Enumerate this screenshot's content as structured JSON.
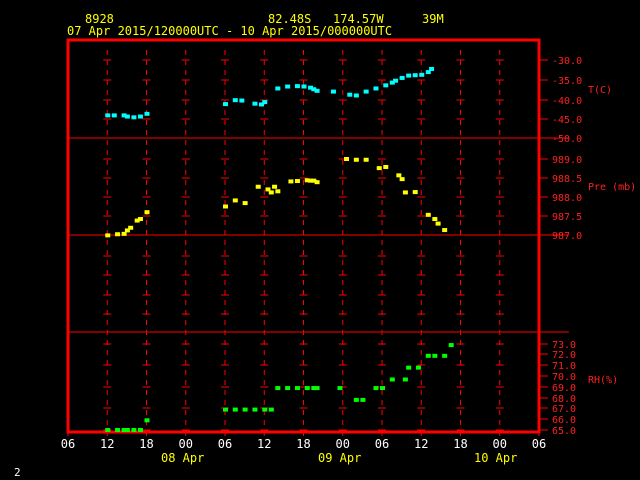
{
  "header": {
    "station_id": "8928",
    "latitude": "82.48S",
    "longitude": "174.57W",
    "elevation": "39M",
    "time_range": "07 Apr 2015/120000UTC - 10 Apr 2015/000000UTC"
  },
  "footer": {
    "page_number": "2"
  },
  "colors": {
    "frame": "#ff0000",
    "temperature": "#00ffff",
    "pressure": "#ffff00",
    "rh": "#00ff00",
    "axis_text": "#ff2020"
  },
  "x_axis": {
    "hour_ticks": [
      "06",
      "12",
      "18",
      "00",
      "06",
      "12",
      "18",
      "00",
      "06",
      "12",
      "18",
      "00",
      "06"
    ],
    "day_labels": [
      "08 Apr",
      "09 Apr",
      "10 Apr"
    ]
  },
  "chart_data": [
    {
      "type": "scatter",
      "title": "",
      "ylabel": "T(C)",
      "ylim": [
        -50.0,
        -30.0
      ],
      "yticks": [
        "-30.0",
        "-35.0",
        "-40.0",
        "-45.0",
        "-50.0"
      ],
      "x_units": "hours since 07 Apr 2015 06 UTC",
      "xlim": [
        0,
        72
      ],
      "series": [
        {
          "name": "T(C)",
          "color": "#00ffff",
          "x": [
            6,
            7,
            8.5,
            9,
            10,
            11,
            12,
            24,
            25.5,
            26.5,
            28.5,
            29.5,
            30,
            32,
            33.5,
            35,
            36,
            37,
            37.5,
            38,
            40.5,
            43,
            44,
            45.5,
            47,
            48.5,
            49.5,
            50,
            51,
            52,
            53,
            54,
            55,
            55.5
          ],
          "y": [
            -44.2,
            -44.2,
            -44.2,
            -44.5,
            -44.7,
            -44.5,
            -43.8,
            -41.3,
            -40.3,
            -40.4,
            -41.2,
            -41.4,
            -40.8,
            -37.3,
            -36.8,
            -36.7,
            -36.8,
            -37.1,
            -37.5,
            -37.9,
            -38.1,
            -38.9,
            -39.1,
            -38.1,
            -37.3,
            -36.5,
            -35.8,
            -35.3,
            -34.6,
            -34.0,
            -33.9,
            -33.8,
            -33.1,
            -32.3
          ]
        }
      ]
    },
    {
      "type": "scatter",
      "title": "",
      "ylabel": "Pre (mb)",
      "ylim": [
        986.8,
        989.2
      ],
      "yticks": [
        "989.0",
        "988.5",
        "988.0",
        "987.5",
        "987.0"
      ],
      "x_units": "hours since 07 Apr 2015 06 UTC",
      "xlim": [
        0,
        72
      ],
      "series": [
        {
          "name": "Pre (mb)",
          "color": "#ffff00",
          "x": [
            6,
            7.5,
            8.5,
            9,
            9.5,
            10.5,
            11,
            12,
            24,
            25.5,
            27,
            29,
            30.5,
            31,
            31.5,
            32,
            34,
            35,
            36.5,
            37,
            37.5,
            38,
            42.5,
            44,
            45.5,
            47.5,
            48.5,
            50.5,
            51,
            51.5,
            53,
            55,
            56,
            56.5,
            57.5
          ],
          "y": [
            986.99,
            987.02,
            987.03,
            987.12,
            987.19,
            987.38,
            987.42,
            987.6,
            987.75,
            987.91,
            987.84,
            988.27,
            988.2,
            988.12,
            988.27,
            988.15,
            988.41,
            988.42,
            988.44,
            988.43,
            988.43,
            988.39,
            989.0,
            988.98,
            988.98,
            988.76,
            988.79,
            988.57,
            988.47,
            988.12,
            988.13,
            987.53,
            987.42,
            987.3,
            987.13
          ]
        }
      ]
    },
    {
      "type": "scatter",
      "title": "",
      "ylabel": "RH(%)",
      "ylim": [
        65.0,
        73.5
      ],
      "yticks": [
        "73.0",
        "72.0",
        "71.0",
        "70.0",
        "69.0",
        "68.0",
        "67.0",
        "66.0",
        "65.0"
      ],
      "x_units": "hours since 07 Apr 2015 06 UTC",
      "xlim": [
        0,
        72
      ],
      "series": [
        {
          "name": "RH(%)",
          "color": "#00ff00",
          "x": [
            6,
            7.5,
            8.5,
            9,
            10,
            11,
            12,
            24,
            25.5,
            27,
            28.5,
            30,
            31,
            32,
            33.5,
            35,
            36.5,
            37.5,
            38,
            41.5,
            44,
            45,
            47,
            48,
            49.5,
            51.5,
            52,
            53.5,
            55,
            56,
            57.5,
            58.5
          ],
          "y": [
            65.0,
            65.0,
            65.0,
            65.0,
            65.0,
            65.0,
            65.9,
            66.9,
            66.9,
            66.9,
            66.9,
            66.9,
            66.9,
            68.9,
            68.9,
            68.9,
            68.9,
            68.9,
            68.9,
            68.9,
            67.8,
            67.8,
            68.9,
            68.9,
            69.7,
            69.7,
            70.8,
            70.8,
            71.9,
            71.9,
            71.9,
            72.9
          ]
        }
      ]
    }
  ]
}
